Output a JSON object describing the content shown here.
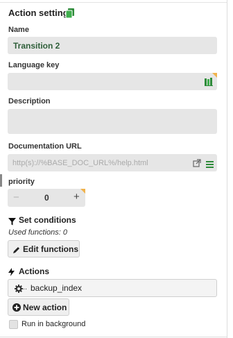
{
  "header": {
    "title": "Action settings",
    "icon": "copy-icon"
  },
  "name": {
    "label": "Name",
    "value": "Transition 2"
  },
  "language_key": {
    "label": "Language key",
    "value": "",
    "icon": "book-icon"
  },
  "description": {
    "label": "Description",
    "value": ""
  },
  "documentation": {
    "label": "Documentation URL",
    "placeholder": "http(s)://%BASE_DOC_URL%/help.html",
    "icons": [
      "external-link-icon",
      "menu-icon"
    ]
  },
  "priority": {
    "label": "priority",
    "value": "0",
    "minus": "−",
    "plus": "+"
  },
  "conditions": {
    "label": "Set conditions",
    "used_functions": "Used functions: 0",
    "edit_button": "Edit functions"
  },
  "actions": {
    "label": "Actions",
    "items": [
      {
        "name": "backup_index",
        "truncated_marker": "..",
        "icon": "gear-icon"
      }
    ],
    "new_button": "New action"
  },
  "background": {
    "label": "Run in background",
    "checked": false
  },
  "colors": {
    "accent_green": "#2e8b3a",
    "corner_orange": "#f0b24b",
    "field_bg": "#e6e6e6"
  }
}
